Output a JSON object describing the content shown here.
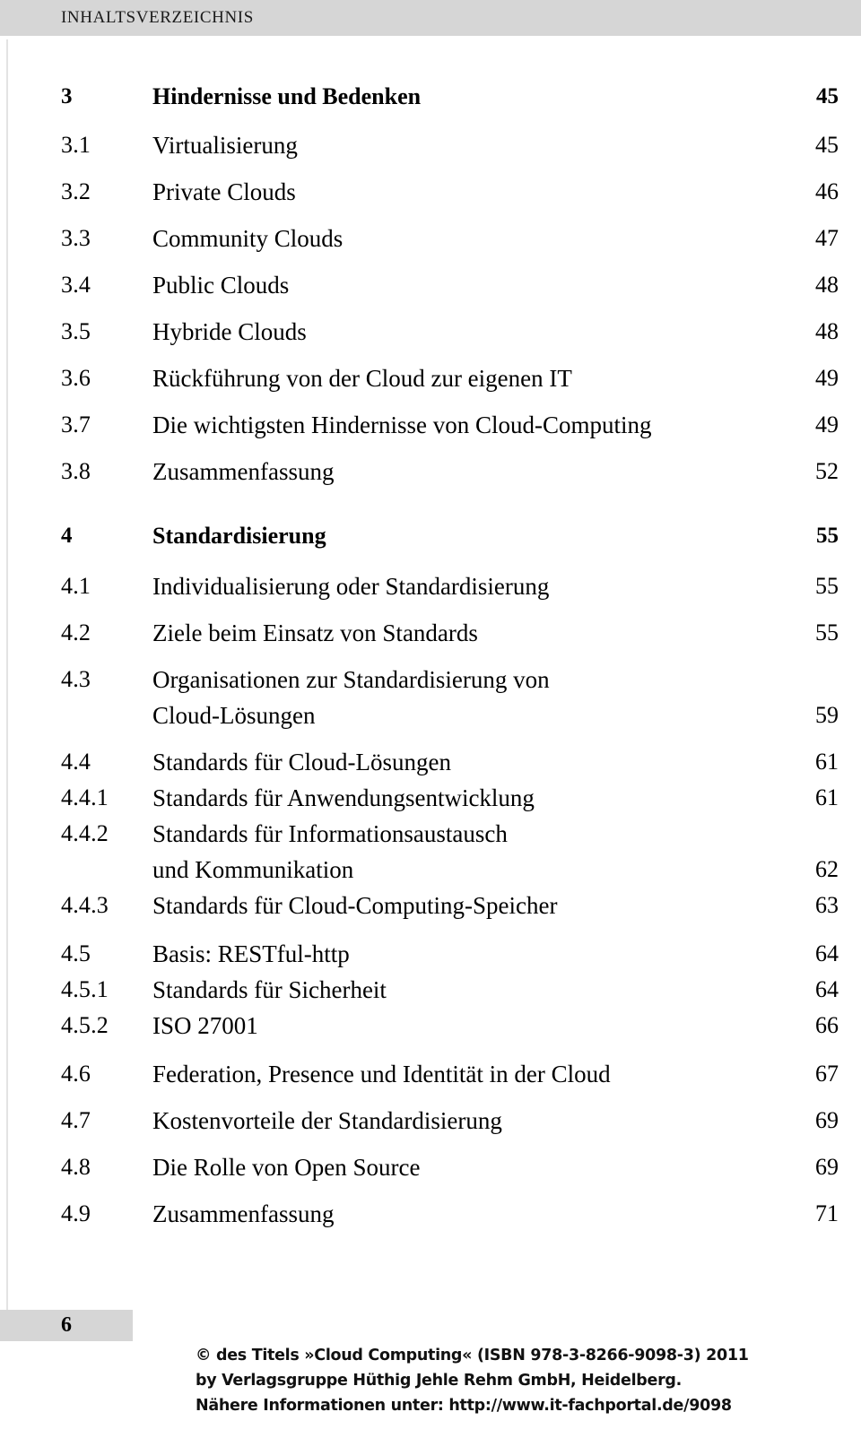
{
  "header": {
    "title": "INHALTSVERZEICHNIS"
  },
  "toc": {
    "entries": [
      {
        "number": "3",
        "lines": [
          "Hindernisse und Bedenken"
        ],
        "page": "45",
        "level": "chapter",
        "gap_before": 0,
        "gap_after": 14
      },
      {
        "number": "3.1",
        "lines": [
          "Virtualisierung"
        ],
        "page": "45",
        "level": "section",
        "gap_before": 0,
        "gap_after": 12
      },
      {
        "number": "3.2",
        "lines": [
          "Private Clouds"
        ],
        "page": "46",
        "level": "section",
        "gap_before": 0,
        "gap_after": 12
      },
      {
        "number": "3.3",
        "lines": [
          "Community Clouds"
        ],
        "page": "47",
        "level": "section",
        "gap_before": 0,
        "gap_after": 12
      },
      {
        "number": "3.4",
        "lines": [
          "Public Clouds"
        ],
        "page": "48",
        "level": "section",
        "gap_before": 0,
        "gap_after": 12
      },
      {
        "number": "3.5",
        "lines": [
          "Hybride Clouds"
        ],
        "page": "48",
        "level": "section",
        "gap_before": 0,
        "gap_after": 12
      },
      {
        "number": "3.6",
        "lines": [
          "Rückführung von der Cloud zur eigenen IT"
        ],
        "page": "49",
        "level": "section",
        "gap_before": 0,
        "gap_after": 12
      },
      {
        "number": "3.7",
        "lines": [
          "Die wichtigsten Hindernisse von Cloud-Computing"
        ],
        "page": "49",
        "level": "section",
        "gap_before": 0,
        "gap_after": 12
      },
      {
        "number": "3.8",
        "lines": [
          "Zusammenfassung"
        ],
        "page": "52",
        "level": "section",
        "gap_before": 0,
        "gap_after": 32
      },
      {
        "number": "4",
        "lines": [
          "Standardisierung"
        ],
        "page": "55",
        "level": "chapter",
        "gap_before": 0,
        "gap_after": 16
      },
      {
        "number": "4.1",
        "lines": [
          "Individualisierung oder Standardisierung"
        ],
        "page": "55",
        "level": "section",
        "gap_before": 0,
        "gap_after": 12
      },
      {
        "number": "4.2",
        "lines": [
          "Ziele beim Einsatz von Standards"
        ],
        "page": "55",
        "level": "section",
        "gap_before": 0,
        "gap_after": 12
      },
      {
        "number": "4.3",
        "lines": [
          "Organisationen zur Standardisierung von",
          "Cloud-Lösungen"
        ],
        "page": "59",
        "level": "section",
        "gap_before": 0,
        "gap_after": 12
      },
      {
        "number": "4.4",
        "lines": [
          "Standards für Cloud-Lösungen"
        ],
        "page": "61",
        "level": "section",
        "gap_before": 0,
        "gap_after": 0
      },
      {
        "number": "4.4.1",
        "lines": [
          "Standards für Anwendungsentwicklung"
        ],
        "page": "61",
        "level": "section",
        "gap_before": 0,
        "gap_after": 0
      },
      {
        "number": "4.4.2",
        "lines": [
          "Standards für Informationsaustausch",
          "und Kommunikation"
        ],
        "page": "62",
        "level": "section",
        "gap_before": 0,
        "gap_after": 0
      },
      {
        "number": "4.4.3",
        "lines": [
          "Standards für Cloud-Computing-Speicher"
        ],
        "page": "63",
        "level": "section",
        "gap_before": 0,
        "gap_after": 14
      },
      {
        "number": "4.5",
        "lines": [
          "Basis: RESTful-http"
        ],
        "page": "64",
        "level": "section",
        "gap_before": 0,
        "gap_after": 0
      },
      {
        "number": "4.5.1",
        "lines": [
          "Standards für Sicherheit"
        ],
        "page": "64",
        "level": "section",
        "gap_before": 0,
        "gap_after": 0
      },
      {
        "number": "4.5.2",
        "lines": [
          "ISO 27001"
        ],
        "page": "66",
        "level": "section",
        "gap_before": 0,
        "gap_after": 14
      },
      {
        "number": "4.6",
        "lines": [
          "Federation, Presence und Identität in der Cloud"
        ],
        "page": "67",
        "level": "section",
        "gap_before": 0,
        "gap_after": 12
      },
      {
        "number": "4.7",
        "lines": [
          "Kostenvorteile der Standardisierung"
        ],
        "page": "69",
        "level": "section",
        "gap_before": 0,
        "gap_after": 12
      },
      {
        "number": "4.8",
        "lines": [
          "Die Rolle von Open Source"
        ],
        "page": "69",
        "level": "section",
        "gap_before": 0,
        "gap_after": 12
      },
      {
        "number": "4.9",
        "lines": [
          "Zusammenfassung"
        ],
        "page": "71",
        "level": "section",
        "gap_before": 0,
        "gap_after": 0
      }
    ]
  },
  "footer": {
    "page_number": "6",
    "copyright_lines": [
      "© des Titels »Cloud Computing« (ISBN 978-3-8266-9098-3) 2011",
      "by Verlagsgruppe Hüthig Jehle Rehm GmbH, Heidelberg.",
      "Nähere Informationen unter: http://www.it-fachportal.de/9098"
    ]
  },
  "colors": {
    "band_gray": "#d6d6d6",
    "rule_gray": "#e3e3e3",
    "text": "#000000",
    "page_background": "#ffffff"
  }
}
